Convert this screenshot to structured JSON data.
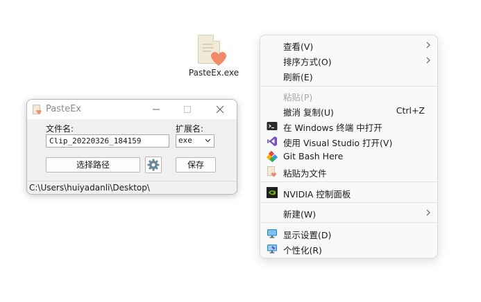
{
  "desktop": {
    "icon_label": "PasteEx.exe"
  },
  "window": {
    "title": "PasteEx",
    "filename_label": "文件名:",
    "filename_value": "Clip_20220326_184159",
    "ext_label": "扩展名:",
    "ext_value": "exe",
    "choose_path_label": "选择路径",
    "save_label": "保存",
    "path": "C:\\Users\\huiyadanli\\Desktop\\"
  },
  "menu": {
    "view": "查看(V)",
    "sort": "排序方式(O)",
    "refresh": "刷新(E)",
    "paste": "粘贴(P)",
    "undo": "撤消 复制(U)",
    "undo_shortcut": "Ctrl+Z",
    "terminal": "在 Windows 终端 中打开",
    "vscode": "使用 Visual Studio 打开(V)",
    "gitbash": "Git Bash Here",
    "pasteasfile": "粘贴为文件",
    "nvidia": "NVIDIA 控制面板",
    "new": "新建(W)",
    "display": "显示设置(D)",
    "personalize": "个性化(R)"
  },
  "colors": {
    "accent_heart": "#f08a6a",
    "nvidia_green": "#76b900",
    "vs_purple": "#7b4fc9",
    "display_blue": "#2d8fd5"
  }
}
